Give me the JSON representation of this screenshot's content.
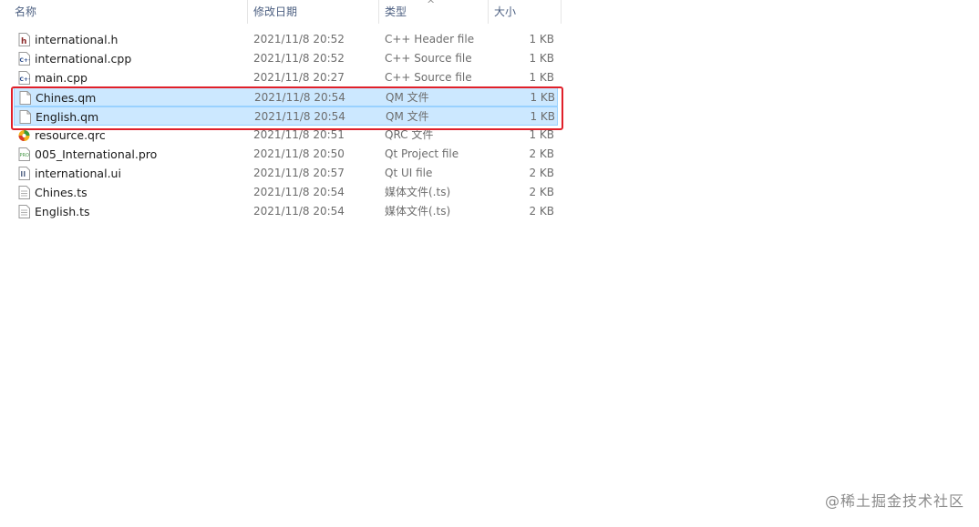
{
  "columns": {
    "name": "名称",
    "date": "修改日期",
    "type": "类型",
    "size": "大小"
  },
  "files": [
    {
      "name": "international.h",
      "date": "2021/11/8 20:52",
      "type": "C++ Header file",
      "size": "1 KB",
      "icon": "cpp-header-file-icon",
      "selected": false
    },
    {
      "name": "international.cpp",
      "date": "2021/11/8 20:52",
      "type": "C++ Source file",
      "size": "1 KB",
      "icon": "cpp-source-file-icon",
      "selected": false
    },
    {
      "name": "main.cpp",
      "date": "2021/11/8 20:27",
      "type": "C++ Source file",
      "size": "1 KB",
      "icon": "cpp-source-file-icon",
      "selected": false
    },
    {
      "name": "Chines.qm",
      "date": "2021/11/8 20:54",
      "type": "QM 文件",
      "size": "1 KB",
      "icon": "blank-file-icon",
      "selected": true
    },
    {
      "name": "English.qm",
      "date": "2021/11/8 20:54",
      "type": "QM 文件",
      "size": "1 KB",
      "icon": "blank-file-icon",
      "selected": true
    },
    {
      "name": "resource.qrc",
      "date": "2021/11/8 20:51",
      "type": "QRC 文件",
      "size": "1 KB",
      "icon": "qrc-file-icon",
      "selected": false
    },
    {
      "name": "005_International.pro",
      "date": "2021/11/8 20:50",
      "type": "Qt Project file",
      "size": "2 KB",
      "icon": "qt-project-file-icon",
      "selected": false
    },
    {
      "name": "international.ui",
      "date": "2021/11/8 20:57",
      "type": "Qt UI file",
      "size": "2 KB",
      "icon": "qt-ui-file-icon",
      "selected": false
    },
    {
      "name": "Chines.ts",
      "date": "2021/11/8 20:54",
      "type": "媒体文件(.ts)",
      "size": "2 KB",
      "icon": "media-file-icon",
      "selected": false
    },
    {
      "name": "English.ts",
      "date": "2021/11/8 20:54",
      "type": "媒体文件(.ts)",
      "size": "2 KB",
      "icon": "media-file-icon",
      "selected": false
    }
  ],
  "colors": {
    "selection_bg": "#cce8ff",
    "selection_border": "#99d1ff",
    "highlight_box": "#e0202a",
    "header_text": "#4d6082"
  },
  "watermark": "@稀土掘金技术社区"
}
